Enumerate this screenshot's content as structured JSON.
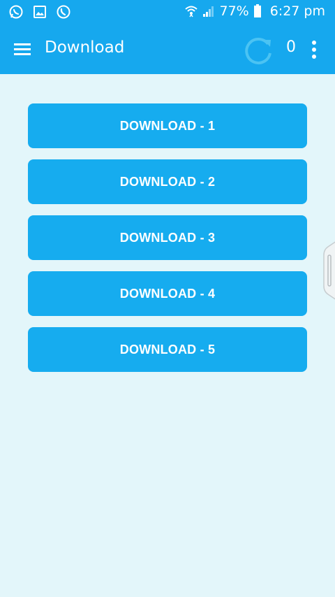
{
  "status_bar": {
    "battery": "77%",
    "time": "6:27 pm",
    "left_icons": [
      "whatsapp-icon",
      "image-icon",
      "phone-icon"
    ],
    "right_icons": [
      "wifi-icon",
      "signal-icon",
      "battery-icon"
    ]
  },
  "app_bar": {
    "title": "Download",
    "count": "0",
    "icons": [
      "menu-icon",
      "refresh-icon",
      "more-vert-icon"
    ],
    "color": "#16a8ee"
  },
  "download_buttons": [
    {
      "label": "DOWNLOAD - 1"
    },
    {
      "label": "DOWNLOAD - 2"
    },
    {
      "label": "DOWNLOAD - 3"
    },
    {
      "label": "DOWNLOAD - 4"
    },
    {
      "label": "DOWNLOAD - 5"
    }
  ],
  "colors": {
    "background": "#e3f6fa",
    "button": "#16acef",
    "text_on_primary": "#ffffff"
  }
}
